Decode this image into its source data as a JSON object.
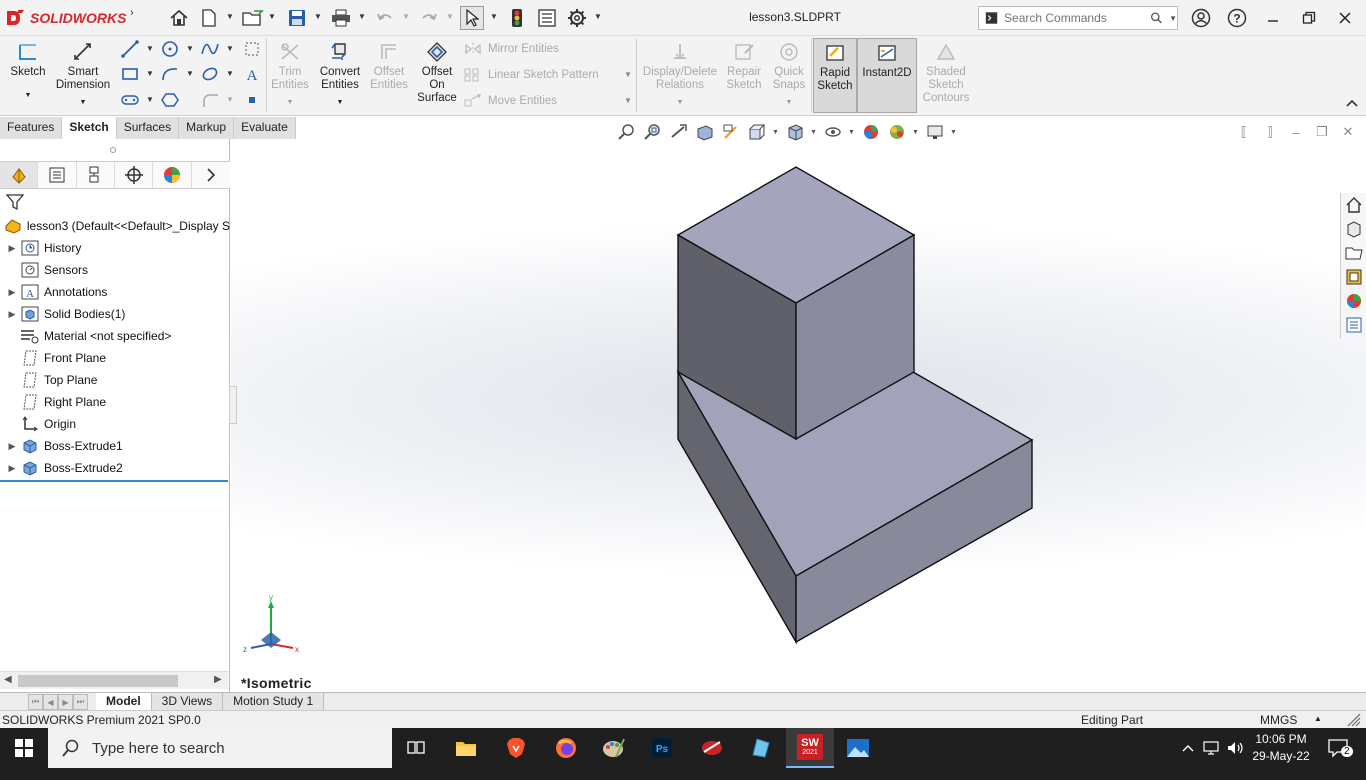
{
  "app": {
    "logo_text": "SOLIDWORKS",
    "document_title": "lesson3.SLDPRT",
    "search_placeholder": "Search Commands"
  },
  "ribbon": {
    "sketch": "Sketch",
    "smart_dimension": "Smart Dimension",
    "trim_entities": "Trim Entities",
    "convert_entities": "Convert Entities",
    "offset_entities": "Offset Entities",
    "offset_on_surface": "Offset On Surface",
    "mirror_entities": "Mirror Entities",
    "linear_sketch_pattern": "Linear Sketch Pattern",
    "move_entities": "Move Entities",
    "display_delete_relations": "Display/Delete Relations",
    "repair_sketch": "Repair Sketch",
    "quick_snaps": "Quick Snaps",
    "rapid_sketch": "Rapid Sketch",
    "instant2d": "Instant2D",
    "shaded_sketch_contours": "Shaded Sketch Contours"
  },
  "command_tabs": [
    "Features",
    "Sketch",
    "Surfaces",
    "Markup",
    "Evaluate"
  ],
  "feature_tree": {
    "root": "lesson3  (Default<<Default>_Display S",
    "items": [
      {
        "label": "History",
        "expandable": true,
        "icon": "history-icon"
      },
      {
        "label": "Sensors",
        "expandable": false,
        "icon": "sensors-icon"
      },
      {
        "label": "Annotations",
        "expandable": true,
        "icon": "annotations-icon"
      },
      {
        "label": "Solid Bodies(1)",
        "expandable": true,
        "icon": "solid-bodies-icon"
      },
      {
        "label": "Material <not specified>",
        "expandable": false,
        "icon": "material-icon"
      },
      {
        "label": "Front Plane",
        "expandable": false,
        "icon": "plane-icon"
      },
      {
        "label": "Top Plane",
        "expandable": false,
        "icon": "plane-icon"
      },
      {
        "label": "Right Plane",
        "expandable": false,
        "icon": "plane-icon"
      },
      {
        "label": "Origin",
        "expandable": false,
        "icon": "origin-icon"
      },
      {
        "label": "Boss-Extrude1",
        "expandable": true,
        "icon": "extrude-icon"
      },
      {
        "label": "Boss-Extrude2",
        "expandable": true,
        "icon": "extrude-icon"
      }
    ]
  },
  "viewport": {
    "view_label": "*Isometric",
    "triad": {
      "x": "x",
      "y": "y",
      "z": "z"
    }
  },
  "bottom_tabs": [
    "Model",
    "3D Views",
    "Motion Study 1"
  ],
  "status": {
    "product": "SOLIDWORKS Premium 2021 SP0.0",
    "mode": "Editing Part",
    "units": "MMGS"
  },
  "taskbar": {
    "search_placeholder": "Type here to search",
    "time": "10:06 PM",
    "date": "29-May-22",
    "notifications": "2",
    "sw_badge": "2021"
  },
  "colors": {
    "brand_red": "#d8262b",
    "model_top": "#a2a3ba",
    "model_left": "#64656f",
    "model_right": "#8a8b9e",
    "selection_blue": "#2b8ad6"
  }
}
